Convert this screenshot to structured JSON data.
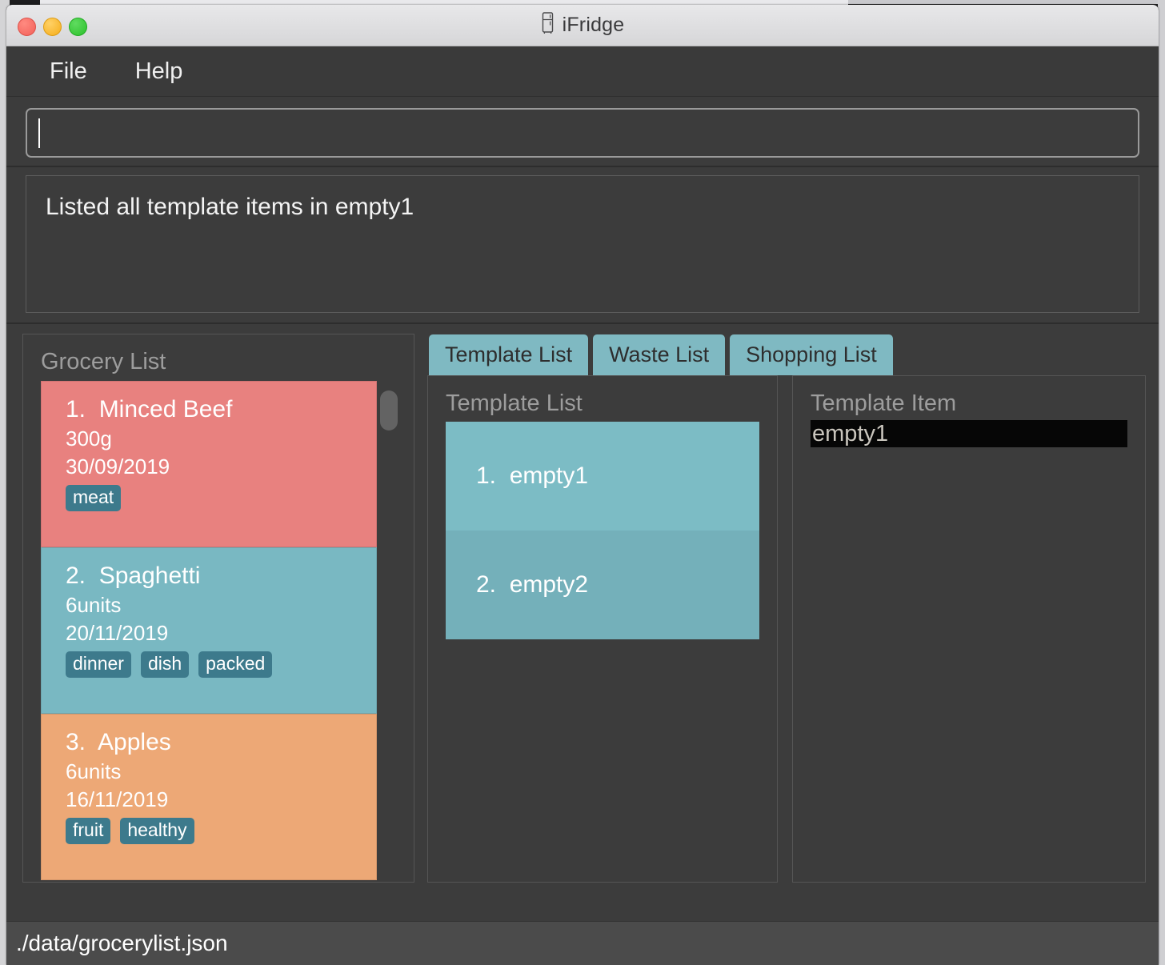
{
  "window": {
    "title": "iFridge",
    "app_icon": "fridge-icon",
    "controls": [
      "close",
      "minimize",
      "zoom"
    ]
  },
  "menubar": {
    "items": [
      {
        "label": "File"
      },
      {
        "label": "Help"
      }
    ]
  },
  "command_entry": {
    "value": "",
    "placeholder": ""
  },
  "console": {
    "lines": [
      "Listed all template items in empty1"
    ]
  },
  "grocery_panel": {
    "heading": "Grocery List",
    "items": [
      {
        "index": "1.",
        "name": "Minced Beef",
        "quantity": "300g",
        "date": "30/09/2019",
        "tags": [
          "meat"
        ],
        "color": "#e8817f"
      },
      {
        "index": "2.",
        "name": "Spaghetti",
        "quantity": "6units",
        "date": "20/11/2019",
        "tags": [
          "dinner",
          "dish",
          "packed"
        ],
        "color": "#79b8c2"
      },
      {
        "index": "3.",
        "name": "Apples",
        "quantity": "6units",
        "date": "16/11/2019",
        "tags": [
          "fruit",
          "healthy"
        ],
        "color": "#eda876"
      }
    ]
  },
  "tabs": [
    {
      "label": "Template List",
      "active": true
    },
    {
      "label": "Waste List",
      "active": false
    },
    {
      "label": "Shopping List",
      "active": false
    }
  ],
  "template_list_panel": {
    "heading": "Template List",
    "items": [
      {
        "index": "1.",
        "name": "empty1",
        "color": "#7cbcc5"
      },
      {
        "index": "2.",
        "name": "empty2",
        "color": "#74b0ba"
      }
    ]
  },
  "template_item_panel": {
    "heading": "Template Item",
    "selected": "empty1"
  },
  "statusbar": {
    "path": "./data/grocerylist.json"
  },
  "colors": {
    "window_bg": "#3c3c3c",
    "titlebar": "#e0e0e2",
    "menubar": "#3a3a3a",
    "tag": "#3d7a8c",
    "tab": "#7fb9c2",
    "statusbar": "#4b4b4b",
    "selection": "#060606"
  }
}
